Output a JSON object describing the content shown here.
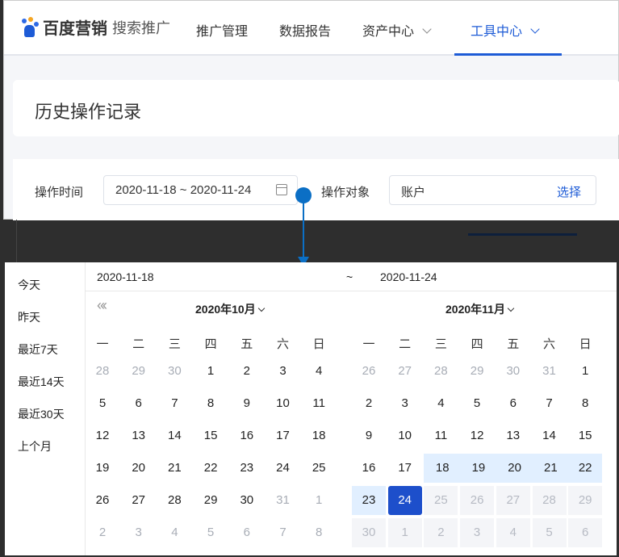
{
  "nav": {
    "brand": "百度营销",
    "product": "搜索推广",
    "items": [
      {
        "label": "推广管理"
      },
      {
        "label": "数据报告"
      },
      {
        "label": "资产中心"
      },
      {
        "label": "工具中心"
      }
    ]
  },
  "page": {
    "title": "历史操作记录"
  },
  "filters": {
    "time_label": "操作时间",
    "time_value": "2020-11-18 ~ 2020-11-24",
    "object_label": "操作对象",
    "object_value": "账户",
    "choose": "选择"
  },
  "picker": {
    "start": "2020-11-18",
    "sep": "~",
    "end": "2020-11-24",
    "shortcuts": [
      "今天",
      "昨天",
      "最近7天",
      "最近14天",
      "最近30天",
      "上个月"
    ],
    "prev_icon": "«‹",
    "weekdays": [
      "一",
      "二",
      "三",
      "四",
      "五",
      "六",
      "日"
    ],
    "months": [
      {
        "title": "2020年10月",
        "days": [
          "28",
          "29",
          "30",
          "1",
          "2",
          "3",
          "4",
          "5",
          "6",
          "7",
          "8",
          "9",
          "10",
          "11",
          "12",
          "13",
          "14",
          "15",
          "16",
          "17",
          "18",
          "19",
          "20",
          "21",
          "22",
          "23",
          "24",
          "25",
          "26",
          "27",
          "28",
          "29",
          "30",
          "31",
          "1",
          "2",
          "3",
          "4",
          "5",
          "6",
          "7",
          "8"
        ],
        "states": "ooo..............................ooooooooo"
      },
      {
        "title": "2020年11月",
        "days": [
          "26",
          "27",
          "28",
          "29",
          "30",
          "31",
          "1",
          "2",
          "3",
          "4",
          "5",
          "6",
          "7",
          "8",
          "9",
          "10",
          "11",
          "12",
          "13",
          "14",
          "15",
          "16",
          "17",
          "18",
          "19",
          "20",
          "21",
          "22",
          "23",
          "24",
          "25",
          "26",
          "27",
          "28",
          "29",
          "30",
          "1",
          "2",
          "3",
          "4",
          "5",
          "6"
        ],
        "states": "oooooo.................rrrrrrsddddddxxxxxx"
      }
    ]
  },
  "colors": {
    "accent": "#1d5bd6",
    "range": "#e1efff",
    "selected": "#1d4fcb"
  }
}
